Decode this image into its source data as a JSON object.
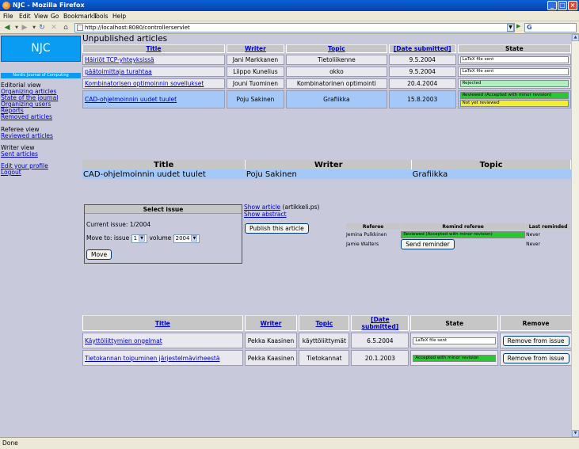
{
  "window": {
    "title": "NJC - Mozilla Firefox"
  },
  "menu": [
    "File",
    "Edit",
    "View",
    "Go",
    "Bookmarks",
    "Tools",
    "Help"
  ],
  "nav": {
    "url": "http://localhost:8080/controllerservlet"
  },
  "sidebar": {
    "logo": "NJC",
    "subtitle": "Nordic Journal of Computing",
    "editorial_heading": "Editorial view",
    "editorial_links": [
      "Organizing articles",
      "State of the journal",
      "Organizing users",
      "Reports",
      "Removed articles"
    ],
    "referee_heading": "Referee view",
    "referee_links": [
      "Reviewed articles"
    ],
    "writer_heading": "Writer view",
    "writer_links": [
      "Sent articles"
    ],
    "profile_link": "Edit your profile",
    "logout_link": "Logout"
  },
  "unpublished": {
    "heading": "Unpublished articles",
    "headers": [
      "Title",
      "Writer",
      "Topic",
      "[Date submitted]",
      "State"
    ],
    "rows": [
      {
        "title": "Häiriöt TCP-yhteyksissä",
        "writer": "Jani Markkanen",
        "topic": "Tietoliikenne",
        "date": "9.5.2004",
        "states": [
          "LaTeX file sent"
        ]
      },
      {
        "title": "päätoimittaja turahtaa",
        "writer": "Liippo Kunelius",
        "topic": "okko",
        "date": "9.5.2004",
        "states": [
          "LaTeX file sent"
        ]
      },
      {
        "title": "Kombinatorisen optimoinnin sovellukset",
        "writer": "Jouni Tuominen",
        "topic": "Kombinatorinen optimointi",
        "date": "20.4.2004",
        "states": [
          "Rejected"
        ]
      },
      {
        "title": "CAD-ohjelmoinnin uudet tuulet",
        "writer": "Poju Sakinen",
        "topic": "Grafiikka",
        "date": "15.8.2003",
        "states": [
          "Reviewed (Accepted with minor revision)",
          "Not yet reviewed"
        ]
      }
    ]
  },
  "detail": {
    "headers": [
      "Title",
      "Writer",
      "Topic"
    ],
    "title": "CAD-ohjelmoinnin uudet tuulet",
    "writer": "Poju Sakinen",
    "topic": "Grafiikka"
  },
  "issue": {
    "heading": "Select issue",
    "current": "Current issue: 1/2004",
    "move_to_label": "Move to: issue",
    "issue_value": "1",
    "volume_label": "volume",
    "volume_value": "2004",
    "move_button": "Move"
  },
  "article_actions": {
    "show_article": "Show article",
    "file_name": "(artikkeli.ps)",
    "show_abstract": "Show abstract",
    "publish_button": "Publish this article"
  },
  "referees": {
    "headers": [
      "Referee",
      "Remind referee",
      "Last reminded"
    ],
    "rows": [
      {
        "name": "Jemina Pulkkinen",
        "remind": "Reviewed (Accepted with minor revision)",
        "last": "Never"
      },
      {
        "name": "Jamie Walters",
        "remind": "Send reminder",
        "last": "Never"
      }
    ]
  },
  "issue_articles": {
    "headers": [
      "Title",
      "Writer",
      "Topic",
      "[Date submitted]",
      "State",
      "Remove"
    ],
    "rows": [
      {
        "title": "Käyttöliittymien ongelmat",
        "writer": "Pekka Kaasinen",
        "topic": "käyttöliittymät",
        "date": "6.5.2004",
        "state": "LaTeX file sent",
        "remove": "Remove from issue"
      },
      {
        "title": "Tietokannan toipuminen järjestelmävirheestä",
        "writer": "Pekka Kaasinen",
        "topic": "Tietokannat",
        "date": "20.1.2003",
        "state": "Accepted with minor revision",
        "remove": "Remove from issue"
      }
    ]
  },
  "status": {
    "text": "Done"
  },
  "colors": {
    "accent": "#0a9cf2",
    "selected_row": "#a4c8f8",
    "background": "#c9c9dc",
    "state_green": "#27c832",
    "state_yellow": "#f0f030"
  }
}
